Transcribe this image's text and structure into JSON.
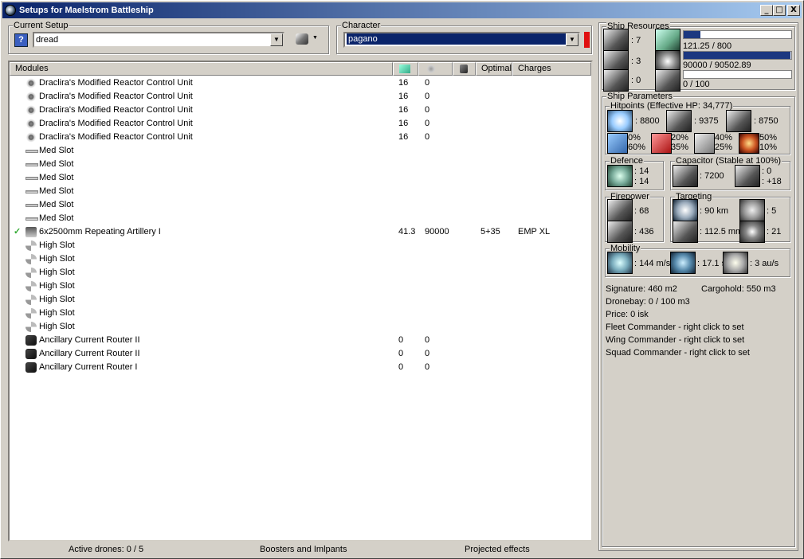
{
  "window": {
    "title": "Setups for Maelstrom Battleship",
    "min": "_",
    "max": "□",
    "close": "X"
  },
  "current_setup": {
    "legend": "Current Setup",
    "value": "dread"
  },
  "character": {
    "legend": "Character",
    "value": "pagano",
    "status_color": "#e01010"
  },
  "modules": {
    "headers": {
      "name": "Modules",
      "optimal": "Optimal",
      "charges": "Charges"
    },
    "rows": [
      {
        "icon": "reactor-icon",
        "name": "Draclira's Modified Reactor Control Unit",
        "cpu": "16",
        "pg": "0",
        "optimal": "",
        "charges": "",
        "active": false
      },
      {
        "icon": "reactor-icon",
        "name": "Draclira's Modified Reactor Control Unit",
        "cpu": "16",
        "pg": "0",
        "optimal": "",
        "charges": "",
        "active": false
      },
      {
        "icon": "reactor-icon",
        "name": "Draclira's Modified Reactor Control Unit",
        "cpu": "16",
        "pg": "0",
        "optimal": "",
        "charges": "",
        "active": false
      },
      {
        "icon": "reactor-icon",
        "name": "Draclira's Modified Reactor Control Unit",
        "cpu": "16",
        "pg": "0",
        "optimal": "",
        "charges": "",
        "active": false
      },
      {
        "icon": "reactor-icon",
        "name": "Draclira's Modified Reactor Control Unit",
        "cpu": "16",
        "pg": "0",
        "optimal": "",
        "charges": "",
        "active": false
      },
      {
        "icon": "med-slot-icon",
        "name": "Med Slot",
        "cpu": "",
        "pg": "",
        "optimal": "",
        "charges": "",
        "active": false
      },
      {
        "icon": "med-slot-icon",
        "name": "Med Slot",
        "cpu": "",
        "pg": "",
        "optimal": "",
        "charges": "",
        "active": false
      },
      {
        "icon": "med-slot-icon",
        "name": "Med Slot",
        "cpu": "",
        "pg": "",
        "optimal": "",
        "charges": "",
        "active": false
      },
      {
        "icon": "med-slot-icon",
        "name": "Med Slot",
        "cpu": "",
        "pg": "",
        "optimal": "",
        "charges": "",
        "active": false
      },
      {
        "icon": "med-slot-icon",
        "name": "Med Slot",
        "cpu": "",
        "pg": "",
        "optimal": "",
        "charges": "",
        "active": false
      },
      {
        "icon": "med-slot-icon",
        "name": "Med Slot",
        "cpu": "",
        "pg": "",
        "optimal": "",
        "charges": "",
        "active": false
      },
      {
        "icon": "artillery-icon",
        "name": "6x2500mm Repeating Artillery I",
        "cpu": "41.3",
        "pg": "90000",
        "optimal": "5+35",
        "charges": "EMP XL",
        "active": true
      },
      {
        "icon": "high-slot-icon",
        "name": "High Slot",
        "cpu": "",
        "pg": "",
        "optimal": "",
        "charges": "",
        "active": false
      },
      {
        "icon": "high-slot-icon",
        "name": "High Slot",
        "cpu": "",
        "pg": "",
        "optimal": "",
        "charges": "",
        "active": false
      },
      {
        "icon": "high-slot-icon",
        "name": "High Slot",
        "cpu": "",
        "pg": "",
        "optimal": "",
        "charges": "",
        "active": false
      },
      {
        "icon": "high-slot-icon",
        "name": "High Slot",
        "cpu": "",
        "pg": "",
        "optimal": "",
        "charges": "",
        "active": false
      },
      {
        "icon": "high-slot-icon",
        "name": "High Slot",
        "cpu": "",
        "pg": "",
        "optimal": "",
        "charges": "",
        "active": false
      },
      {
        "icon": "high-slot-icon",
        "name": "High Slot",
        "cpu": "",
        "pg": "",
        "optimal": "",
        "charges": "",
        "active": false
      },
      {
        "icon": "high-slot-icon",
        "name": "High Slot",
        "cpu": "",
        "pg": "",
        "optimal": "",
        "charges": "",
        "active": false
      },
      {
        "icon": "router-icon",
        "name": "Ancillary Current Router II",
        "cpu": "0",
        "pg": "0",
        "optimal": "",
        "charges": "",
        "active": false
      },
      {
        "icon": "router-icon",
        "name": "Ancillary Current Router II",
        "cpu": "0",
        "pg": "0",
        "optimal": "",
        "charges": "",
        "active": false
      },
      {
        "icon": "router-icon",
        "name": "Ancillary Current Router I",
        "cpu": "0",
        "pg": "0",
        "optimal": "",
        "charges": "",
        "active": false
      }
    ]
  },
  "status": {
    "drones": "Active drones: 0 / 5",
    "boosters": "Boosters and Imlpants",
    "projected": "Projected effects"
  },
  "ship_resources": {
    "legend": "Ship Resources",
    "turret_slots": ": 7",
    "launcher_slots": ": 3",
    "rig_slots": ": 0",
    "cpu": "121.25 / 800",
    "cpu_fraction": 0.152,
    "powergrid": "90000 / 90502.89",
    "powergrid_fraction": 0.994,
    "calibration": "0 / 100",
    "calibration_fraction": 0
  },
  "ship_params": {
    "legend": "Ship Parameters",
    "hitpoints": {
      "legend": "Hitpoints (Effective HP: 34,777)",
      "shield": ": 8800",
      "armor": ": 9375",
      "hull": ": 8750",
      "em": [
        "0%",
        "60%"
      ],
      "thermal": [
        "20%",
        "35%"
      ],
      "kinetic": [
        "40%",
        "25%"
      ],
      "explosive": [
        "50%",
        "10%"
      ]
    },
    "defence": {
      "legend": "Defence",
      "a": ": 14",
      "b": ": 14"
    },
    "capacitor": {
      "legend": "Capacitor (Stable at 100%)",
      "capacity": ": 7200",
      "delta_a": ": 0",
      "delta_b": ": +18"
    },
    "firepower": {
      "legend": "Firepower",
      "a": ": 68",
      "b": ": 436"
    },
    "targeting": {
      "legend": "Targeting",
      "range": ": 90 km",
      "targets": ": 5",
      "scan": ": 112.5 mm",
      "sensor": ": 21"
    },
    "mobility": {
      "legend": "Mobility",
      "speed": ": 144 m/s",
      "align": ": 17.1 s",
      "warp": ": 3 au/s"
    },
    "signature": "Signature: 460 m2",
    "cargohold": "Cargohold: 550 m3",
    "dronebay": "Dronebay: 0 / 100 m3",
    "price": "Price: 0 isk",
    "fleet": "Fleet Commander - right click to set",
    "wing": "Wing Commander - right click to set",
    "squad": "Squad Commander - right click to set"
  }
}
